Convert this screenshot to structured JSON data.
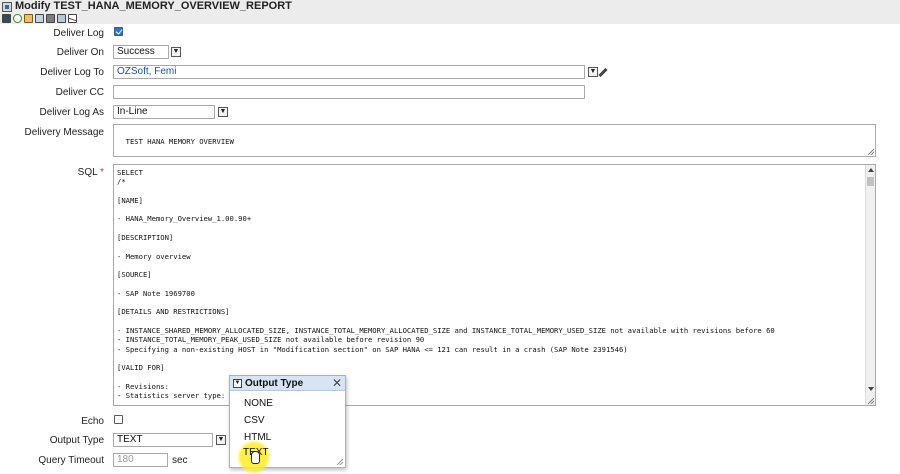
{
  "window": {
    "title": "Modify TEST_HANA_MEMORY_OVERVIEW_REPORT",
    "toolbar_icons": [
      "save-icon",
      "refresh-icon",
      "copy-icon",
      "paste-icon",
      "delete-icon",
      "duplicate-icon",
      "email-icon"
    ]
  },
  "form": {
    "deliver_log": {
      "label": "Deliver Log",
      "checked": true
    },
    "deliver_on": {
      "label": "Deliver On",
      "value": "Success"
    },
    "deliver_log_to": {
      "label": "Deliver Log To",
      "value": "OZSoft, Femi"
    },
    "deliver_cc": {
      "label": "Deliver CC",
      "value": ""
    },
    "deliver_log_as": {
      "label": "Deliver Log As",
      "value": "In-Line"
    },
    "delivery_message": {
      "label": "Delivery Message",
      "value": "TEST HANA MEMORY OVERVIEW"
    },
    "sql": {
      "label": "SQL",
      "required_marker": "*",
      "lines": [
        "SELECT",
        "/*",
        "",
        "[NAME]",
        "",
        "- HANA_Memory_Overview_1.00.90+",
        "",
        "[DESCRIPTION]",
        "",
        "- Memory overview",
        "",
        "[SOURCE]",
        "",
        "- SAP Note 1969700",
        "",
        "[DETAILS AND RESTRICTIONS]",
        "",
        "- INSTANCE_SHARED_MEMORY_ALLOCATED_SIZE, INSTANCE_TOTAL_MEMORY_ALLOCATED_SIZE and INSTANCE_TOTAL_MEMORY_USED_SIZE not available with revisions before 60",
        "- INSTANCE_TOTAL_MEMORY_PEAK_USED_SIZE not available before revision 90",
        "- Specifying a non-existing HOST in \"Modification section\" on SAP HANA <= 121 can result in a crash (SAP Note 2391546)",
        "",
        "[VALID FOR]",
        "",
        "- Revisions:",
        "- Statistics server type: a"
      ]
    },
    "echo": {
      "label": "Echo",
      "checked": false
    },
    "output_type": {
      "label": "Output Type",
      "value": "TEXT"
    },
    "query_timeout": {
      "label": "Query Timeout",
      "value": "180",
      "unit": "sec"
    }
  },
  "output_type_popup": {
    "title": "Output Type",
    "options": [
      "NONE",
      "CSV",
      "HTML",
      "TEXT"
    ],
    "hovered": "TEXT"
  },
  "dropdown_glyph": "▼"
}
